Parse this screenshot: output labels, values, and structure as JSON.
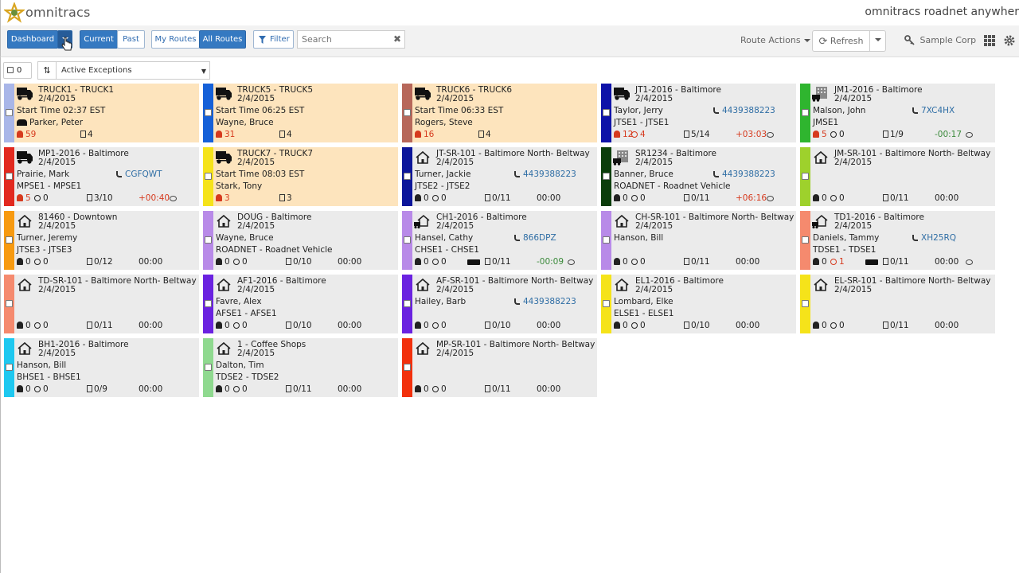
{
  "header": {
    "brand": "omnitracs",
    "product": "omnitracs roadnet anywher"
  },
  "toolbar": {
    "dashboard": "Dashboard",
    "current": "Current",
    "past": "Past",
    "my_routes": "My Routes",
    "all_routes": "All Routes",
    "filter": "Filter",
    "search_placeholder": "Search",
    "route_actions": "Route Actions",
    "refresh": "Refresh",
    "company": "Sample Corp"
  },
  "subbar": {
    "selected_count": "0",
    "filter_value": "Active Exceptions"
  },
  "colors": {
    "primary": "#3579c1",
    "highlight_card": "#fde4bd",
    "card": "#ebebeb",
    "alert": "#d63a1e",
    "positive": "#3b8a3b",
    "phone_link": "#2e6da4"
  },
  "routes": [
    {
      "icon": "truck-icon",
      "strip": "#a9b6e8",
      "highlight": true,
      "title": "TRUCK1 - TRUCK1",
      "date": "2/4/2015",
      "line3": "Start Time 02:37 EST",
      "line4": "Parker, Peter",
      "line4_icon": "people-icon",
      "phone": "",
      "alerts": "59",
      "alert_red": true,
      "late": "",
      "late_red": false,
      "progress": "4",
      "time": "",
      "time_color": "",
      "note": false
    },
    {
      "icon": "truck-icon",
      "strip": "#1560d8",
      "highlight": true,
      "title": "TRUCK5 - TRUCK5",
      "date": "2/4/2015",
      "line3": "Start Time 06:25 EST",
      "line4": "Wayne, Bruce",
      "line4_icon": "",
      "phone": "",
      "alerts": "31",
      "alert_red": true,
      "late": "",
      "late_red": false,
      "progress": "4",
      "time": "",
      "time_color": "",
      "note": false
    },
    {
      "icon": "truck-icon",
      "strip": "#b7675a",
      "highlight": true,
      "title": "TRUCK6 - TRUCK6",
      "date": "2/4/2015",
      "line3": "Start Time 06:33 EST",
      "line4": "Rogers, Steve",
      "line4_icon": "",
      "phone": "",
      "alerts": "16",
      "alert_red": true,
      "late": "",
      "late_red": false,
      "progress": "4",
      "time": "",
      "time_color": "",
      "note": false
    },
    {
      "icon": "truck-icon",
      "strip": "#0e12a8",
      "highlight": false,
      "title": "JT1-2016 - Baltimore",
      "date": "2/4/2015",
      "line3": "Taylor, Jerry",
      "line4": "JTSE1 - JTSE1",
      "line4_icon": "",
      "phone": "4439388223",
      "alerts": "12",
      "alert_red": true,
      "late": "4",
      "late_red": true,
      "progress": "5/14",
      "time": "+03:03",
      "time_color": "red",
      "note": true
    },
    {
      "icon": "building-truck-icon",
      "strip": "#2fb52f",
      "highlight": false,
      "title": "JM1-2016 - Baltimore",
      "date": "2/4/2015",
      "line3": "Malson, John",
      "line4": "JMSE1",
      "line4_icon": "",
      "phone": "7XC4HX",
      "alerts": "5",
      "alert_red": true,
      "late": "0",
      "late_red": false,
      "progress": "1/9",
      "time": "-00:17",
      "time_color": "green",
      "note": true
    },
    {
      "icon": "truck-icon",
      "strip": "#e2291f",
      "highlight": false,
      "title": "MP1-2016 - Baltimore",
      "date": "2/4/2015",
      "line3": "Prairie, Mark",
      "line4": "MPSE1 - MPSE1",
      "line4_icon": "",
      "phone": "CGFQWT",
      "alerts": "5",
      "alert_red": true,
      "late": "0",
      "late_red": false,
      "progress": "3/10",
      "time": "+00:40",
      "time_color": "red",
      "note": true
    },
    {
      "icon": "truck-icon",
      "strip": "#f5e31a",
      "highlight": true,
      "title": "TRUCK7 - TRUCK7",
      "date": "2/4/2015",
      "line3": "Start Time 08:03 EST",
      "line4": "Stark, Tony",
      "line4_icon": "",
      "phone": "",
      "alerts": "3",
      "alert_red": true,
      "late": "",
      "late_red": false,
      "progress": "3",
      "time": "",
      "time_color": "",
      "note": false
    },
    {
      "icon": "house-icon",
      "strip": "#0c169a",
      "highlight": false,
      "title": "JT-SR-101 - Baltimore North- Beltway",
      "date": "2/4/2015",
      "line3": "Turner, Jackie",
      "line4": "JTSE2 - JTSE2",
      "line4_icon": "",
      "phone": "4439388223",
      "alerts": "0",
      "alert_red": false,
      "late": "0",
      "late_red": false,
      "progress": "0/11",
      "time": "00:00",
      "time_color": "",
      "note": false
    },
    {
      "icon": "building-truck-icon",
      "strip": "#0b3d0b",
      "highlight": false,
      "title": "SR1234 - Baltimore",
      "date": "2/4/2015",
      "line3": "Banner, Bruce",
      "line4": "ROADNET - Roadnet Vehicle",
      "line4_icon": "",
      "phone": "4439388223",
      "alerts": "0",
      "alert_red": false,
      "late": "0",
      "late_red": false,
      "progress": "0/11",
      "time": "+06:16",
      "time_color": "red",
      "note": true
    },
    {
      "icon": "house-icon",
      "strip": "#9ed12c",
      "highlight": false,
      "title": "JM-SR-101 - Baltimore North- Beltway",
      "date": "2/4/2015",
      "line3": "",
      "line4": "",
      "line4_icon": "",
      "phone": "",
      "alerts": "0",
      "alert_red": false,
      "late": "0",
      "late_red": false,
      "progress": "0/11",
      "time": "00:00",
      "time_color": "",
      "note": false
    },
    {
      "icon": "house-icon",
      "strip": "#f79a10",
      "highlight": false,
      "title": "81460 - Downtown",
      "date": "2/4/2015",
      "line3": "Turner, Jeremy",
      "line4": "JTSE3 - JTSE3",
      "line4_icon": "",
      "phone": "",
      "alerts": "0",
      "alert_red": false,
      "late": "0",
      "late_red": false,
      "progress": "0/12",
      "time": "00:00",
      "time_color": "",
      "note": false
    },
    {
      "icon": "house-icon",
      "strip": "#b88ae8",
      "highlight": false,
      "title": "DOUG - Baltimore",
      "date": "2/4/2015",
      "line3": "Wayne, Bruce",
      "line4": "ROADNET - Roadnet Vehicle",
      "line4_icon": "",
      "phone": "",
      "alerts": "0",
      "alert_red": false,
      "late": "0",
      "late_red": false,
      "progress": "0/10",
      "time": "00:00",
      "time_color": "",
      "note": false
    },
    {
      "icon": "house-truck-icon",
      "strip": "#b88ae8",
      "highlight": false,
      "title": "CH1-2016 - Baltimore",
      "date": "2/4/2015",
      "line3": "Hansel, Cathy",
      "line4": "CHSE1 - CHSE1",
      "line4_icon": "",
      "phone": "866DPZ",
      "alerts": "0",
      "alert_red": false,
      "late": "0",
      "late_red": false,
      "progress": "0/11",
      "time": "-00:09",
      "time_color": "green",
      "note": true,
      "truckglyph": true
    },
    {
      "icon": "house-icon",
      "strip": "#b88ae8",
      "highlight": false,
      "title": "CH-SR-101 - Baltimore North- Beltway",
      "date": "2/4/2015",
      "line3": "Hanson, Bill",
      "line4": "",
      "line4_icon": "",
      "phone": "",
      "alerts": "0",
      "alert_red": false,
      "late": "0",
      "late_red": false,
      "progress": "0/11",
      "time": "00:00",
      "time_color": "",
      "note": false
    },
    {
      "icon": "house-truck-icon",
      "strip": "#f58a6e",
      "highlight": false,
      "title": "TD1-2016 - Baltimore",
      "date": "2/4/2015",
      "line3": "Daniels, Tammy",
      "line4": "TDSE1 - TDSE1",
      "line4_icon": "",
      "phone": "XH25RQ",
      "alerts": "0",
      "alert_red": false,
      "late": "1",
      "late_red": true,
      "progress": "0/11",
      "time": "00:00",
      "time_color": "",
      "note": true,
      "truckglyph": true
    },
    {
      "icon": "house-icon",
      "strip": "#f58a6e",
      "highlight": false,
      "title": "TD-SR-101 - Baltimore North- Beltway",
      "date": "2/4/2015",
      "line3": "",
      "line4": "",
      "line4_icon": "",
      "phone": "",
      "alerts": "0",
      "alert_red": false,
      "late": "0",
      "late_red": false,
      "progress": "0/11",
      "time": "00:00",
      "time_color": "",
      "note": false
    },
    {
      "icon": "house-icon",
      "strip": "#6a22e0",
      "highlight": false,
      "title": "AF1-2016 - Baltimore",
      "date": "2/4/2015",
      "line3": "Favre, Alex",
      "line4": "AFSE1 - AFSE1",
      "line4_icon": "",
      "phone": "",
      "alerts": "0",
      "alert_red": false,
      "late": "0",
      "late_red": false,
      "progress": "0/10",
      "time": "00:00",
      "time_color": "",
      "note": false
    },
    {
      "icon": "house-icon",
      "strip": "#6a22e0",
      "highlight": false,
      "title": "AF-SR-101 - Baltimore North- Beltway",
      "date": "2/4/2015",
      "line3": "Hailey, Barb",
      "line4": "",
      "line4_icon": "",
      "phone": "4439388223",
      "alerts": "0",
      "alert_red": false,
      "late": "0",
      "late_red": false,
      "progress": "0/10",
      "time": "00:00",
      "time_color": "",
      "note": false
    },
    {
      "icon": "house-icon",
      "strip": "#f5e31a",
      "highlight": false,
      "title": "EL1-2016 - Baltimore",
      "date": "2/4/2015",
      "line3": "Lombard, Elke",
      "line4": "ELSE1 - ELSE1",
      "line4_icon": "",
      "phone": "",
      "alerts": "0",
      "alert_red": false,
      "late": "0",
      "late_red": false,
      "progress": "0/10",
      "time": "00:00",
      "time_color": "",
      "note": false
    },
    {
      "icon": "house-icon",
      "strip": "#f5e31a",
      "highlight": false,
      "title": "EL-SR-101 - Baltimore North- Beltway",
      "date": "2/4/2015",
      "line3": "",
      "line4": "",
      "line4_icon": "",
      "phone": "",
      "alerts": "0",
      "alert_red": false,
      "late": "0",
      "late_red": false,
      "progress": "0/11",
      "time": "00:00",
      "time_color": "",
      "note": false
    },
    {
      "icon": "house-icon",
      "strip": "#1ec8f0",
      "highlight": false,
      "title": "BH1-2016 - Baltimore",
      "date": "2/4/2015",
      "line3": "Hanson, Bill",
      "line4": "BHSE1 - BHSE1",
      "line4_icon": "",
      "phone": "",
      "alerts": "0",
      "alert_red": false,
      "late": "0",
      "late_red": false,
      "progress": "0/9",
      "time": "00:00",
      "time_color": "",
      "note": false
    },
    {
      "icon": "house-icon",
      "strip": "#8fd98f",
      "highlight": false,
      "title": "1 - Coffee Shops",
      "date": "2/4/2015",
      "line3": "Dalton, Tim",
      "line4": "TDSE2 - TDSE2",
      "line4_icon": "",
      "phone": "",
      "alerts": "0",
      "alert_red": false,
      "late": "0",
      "late_red": false,
      "progress": "0/11",
      "time": "00:00",
      "time_color": "",
      "note": false
    },
    {
      "icon": "house-icon",
      "strip": "#f2300c",
      "highlight": false,
      "title": "MP-SR-101 - Baltimore North- Beltway",
      "date": "2/4/2015",
      "line3": "",
      "line4": "",
      "line4_icon": "",
      "phone": "",
      "alerts": "0",
      "alert_red": false,
      "late": "0",
      "late_red": false,
      "progress": "0/11",
      "time": "00:00",
      "time_color": "",
      "note": false
    }
  ]
}
